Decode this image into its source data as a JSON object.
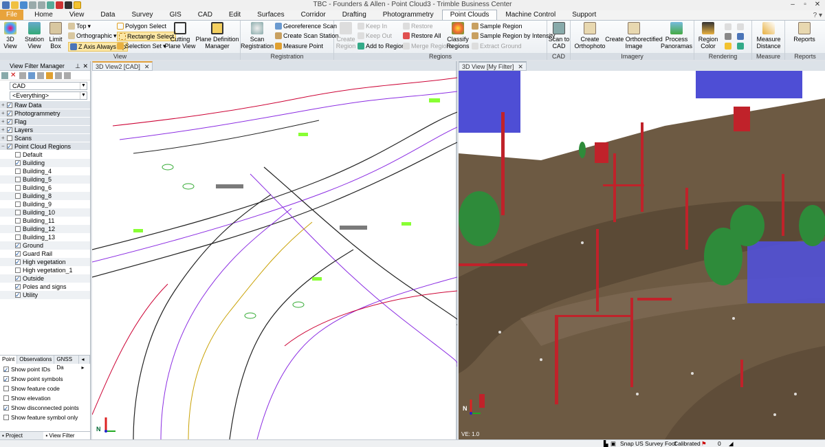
{
  "window": {
    "title": "TBC - Founders & Allen - Point Cloud3 - Trimble Business Center"
  },
  "tabs": [
    {
      "label": "File",
      "kind": "file"
    },
    {
      "label": "Home"
    },
    {
      "label": "View"
    },
    {
      "label": "Data"
    },
    {
      "label": "Survey"
    },
    {
      "label": "GIS"
    },
    {
      "label": "CAD"
    },
    {
      "label": "Edit"
    },
    {
      "label": "Surfaces"
    },
    {
      "label": "Corridor"
    },
    {
      "label": "Drafting"
    },
    {
      "label": "Photogrammetry"
    },
    {
      "label": "Point Clouds",
      "active": true
    },
    {
      "label": "Machine Control"
    },
    {
      "label": "Support"
    }
  ],
  "ribbon": {
    "view": {
      "label": "View",
      "btn_3d": "3D\nView",
      "btn_station": "Station\nView",
      "btn_limit": "Limit\nBox",
      "top": "Top",
      "orthographic": "Orthographic",
      "z_axis": "Z Axis Always Up",
      "polygon": "Polygon Select",
      "rectangle": "Rectangle Select",
      "selection_set": "Selection Set",
      "cutting": "Cutting\nPlane View",
      "plane_def": "Plane Definition\nManager"
    },
    "registration": {
      "label": "Registration",
      "scan_reg": "Scan\nRegistration",
      "georef": "Georeference Scan",
      "create_station": "Create Scan Station",
      "measure_point": "Measure Point"
    },
    "regions": {
      "label": "Regions",
      "create_region": "Create\nRegion",
      "keep_in": "Keep In",
      "keep_out": "Keep Out",
      "add_to_region": "Add to Region",
      "restore": "Restore",
      "restore_all": "Restore All",
      "merge": "Merge Regions",
      "classify": "Classify\nRegions",
      "sample": "Sample Region",
      "sample_int": "Sample Region by Intensity",
      "extract_ground": "Extract Ground"
    },
    "cad": {
      "label": "CAD",
      "scan_to_cad": "Scan to\nCAD"
    },
    "imagery": {
      "label": "Imagery",
      "ortho": "Create\nOrthophoto",
      "orthorect": "Create Orthorectified\nImage",
      "panoramas": "Process\nPanoramas"
    },
    "rendering": {
      "label": "Rendering",
      "region_color": "Region\nColor"
    },
    "measure": {
      "label": "Measure",
      "measure_distance": "Measure\nDistance"
    },
    "reports": {
      "label": "Reports",
      "reports": "Reports"
    }
  },
  "left_panel": {
    "title": "View Filter Manager",
    "filter_value": "CAD",
    "everything_value": "<Everything>",
    "tree": [
      {
        "label": "Raw Data",
        "checked": true
      },
      {
        "label": "Photogrammetry",
        "checked": true
      },
      {
        "label": "Flag",
        "checked": true
      },
      {
        "label": "Layers",
        "checked": true
      },
      {
        "label": "Scans",
        "checked": false
      },
      {
        "label": "Point Cloud Regions",
        "checked": true,
        "expanded": true
      }
    ],
    "regions": [
      {
        "label": "Default",
        "checked": false
      },
      {
        "label": "Building",
        "checked": true
      },
      {
        "label": "Building_4",
        "checked": false
      },
      {
        "label": "Building_5",
        "checked": false
      },
      {
        "label": "Building_6",
        "checked": false
      },
      {
        "label": "Building_8",
        "checked": false
      },
      {
        "label": "Building_9",
        "checked": false
      },
      {
        "label": "Building_10",
        "checked": false
      },
      {
        "label": "Building_11",
        "checked": false
      },
      {
        "label": "Building_12",
        "checked": false
      },
      {
        "label": "Building_13",
        "checked": false
      },
      {
        "label": "Ground",
        "checked": true
      },
      {
        "label": "Guard Rail",
        "checked": true
      },
      {
        "label": "High vegetation",
        "checked": true
      },
      {
        "label": "High vegetation_1",
        "checked": false
      },
      {
        "label": "Outside",
        "checked": true
      },
      {
        "label": "Poles and signs",
        "checked": true
      },
      {
        "label": "Utility",
        "checked": true
      }
    ],
    "bottom_tabs": [
      "Point",
      "Observations",
      "GNSS Da"
    ],
    "options": [
      {
        "label": "Show point IDs",
        "checked": true
      },
      {
        "label": "Show point symbols",
        "checked": true
      },
      {
        "label": "Show feature code",
        "checked": false
      },
      {
        "label": "Show elevation",
        "checked": false
      },
      {
        "label": "Show disconnected points",
        "checked": true
      },
      {
        "label": "Show feature symbol only",
        "checked": false
      }
    ],
    "footer_tabs": [
      "Project Explorer",
      "View Filter Man..."
    ]
  },
  "views": {
    "cad_tab": "3D View2 [CAD]",
    "pc_tab": "3D View [My Filter]",
    "cad_axis_label": "N",
    "pc_axis_label": "N",
    "ve_label": "VE: 1.0"
  },
  "statusbar": {
    "snap": "Snap",
    "units": "US Survey  Foot",
    "calibrated": "Calibrated",
    "count": "0"
  },
  "colors": {
    "accent": "#e2a13c",
    "ground": "#6d5a43",
    "building": "#3b3bd0",
    "vegetation": "#2e8b3a",
    "poles": "#c0222a"
  }
}
